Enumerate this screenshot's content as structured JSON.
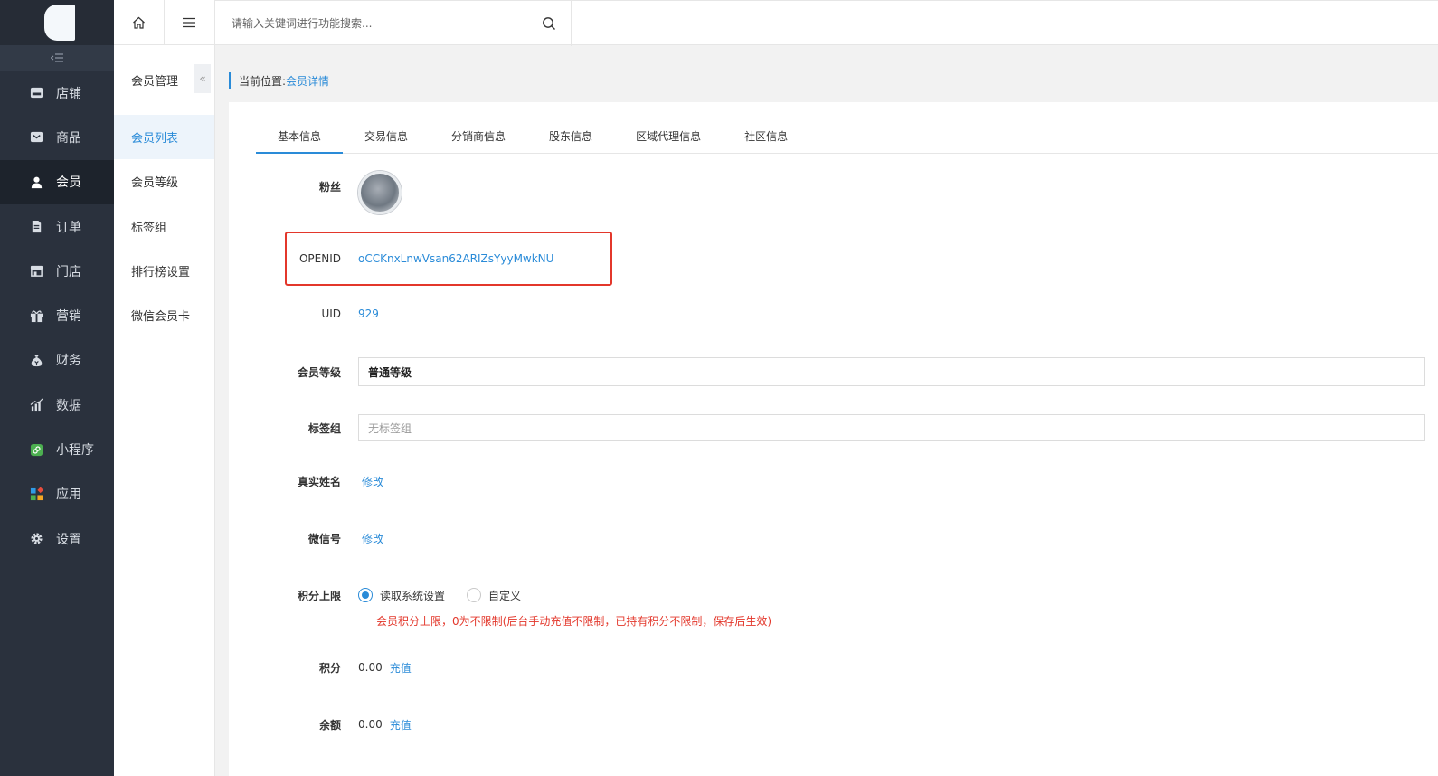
{
  "sidebar": {
    "items": [
      {
        "label": "店铺",
        "icon": "store-icon"
      },
      {
        "label": "商品",
        "icon": "goods-icon"
      },
      {
        "label": "会员",
        "icon": "user-icon"
      },
      {
        "label": "订单",
        "icon": "order-icon"
      },
      {
        "label": "门店",
        "icon": "shop-icon"
      },
      {
        "label": "营销",
        "icon": "gift-icon"
      },
      {
        "label": "财务",
        "icon": "money-bag-icon"
      },
      {
        "label": "数据",
        "icon": "chart-icon"
      },
      {
        "label": "小程序",
        "icon": "miniprogram-icon"
      },
      {
        "label": "应用",
        "icon": "apps-icon"
      },
      {
        "label": "设置",
        "icon": "gear-icon"
      }
    ],
    "active_index": 2
  },
  "subbar": {
    "title": "会员管理",
    "collapse_glyph": "«",
    "items": [
      "会员列表",
      "会员等级",
      "标签组",
      "排行榜设置",
      "微信会员卡"
    ],
    "active_index": 0
  },
  "search": {
    "placeholder": "请输入关键词进行功能搜索..."
  },
  "breadcrumb": {
    "prefix": "当前位置:",
    "current": "会员详情"
  },
  "tabs": [
    "基本信息",
    "交易信息",
    "分销商信息",
    "股东信息",
    "区域代理信息",
    "社区信息"
  ],
  "active_tab": 0,
  "form": {
    "fans_label": "粉丝",
    "openid_label": "OPENID",
    "openid_value": "oCCKnxLnwVsan62ARIZsYyyMwkNU",
    "uid_label": "UID",
    "uid_value": "929",
    "level_label": "会员等级",
    "level_value": "普通等级",
    "tag_label": "标签组",
    "tag_placeholder": "无标签组",
    "realname_label": "真实姓名",
    "realname_action": "修改",
    "wechat_label": "微信号",
    "wechat_action": "修改",
    "points_limit_label": "积分上限",
    "radio_system": "读取系统设置",
    "radio_custom": "自定义",
    "points_limit_hint": "会员积分上限，0为不限制(后台手动充值不限制，已持有积分不限制，保存后生效)",
    "points_label": "积分",
    "points_value": "0.00",
    "points_action": "充值",
    "balance_label": "余额",
    "balance_value": "0.00",
    "balance_action": "充值"
  },
  "colors": {
    "accent": "#2a8bd8",
    "sidebar_bg": "#2a313d",
    "highlight": "#e3372b"
  }
}
